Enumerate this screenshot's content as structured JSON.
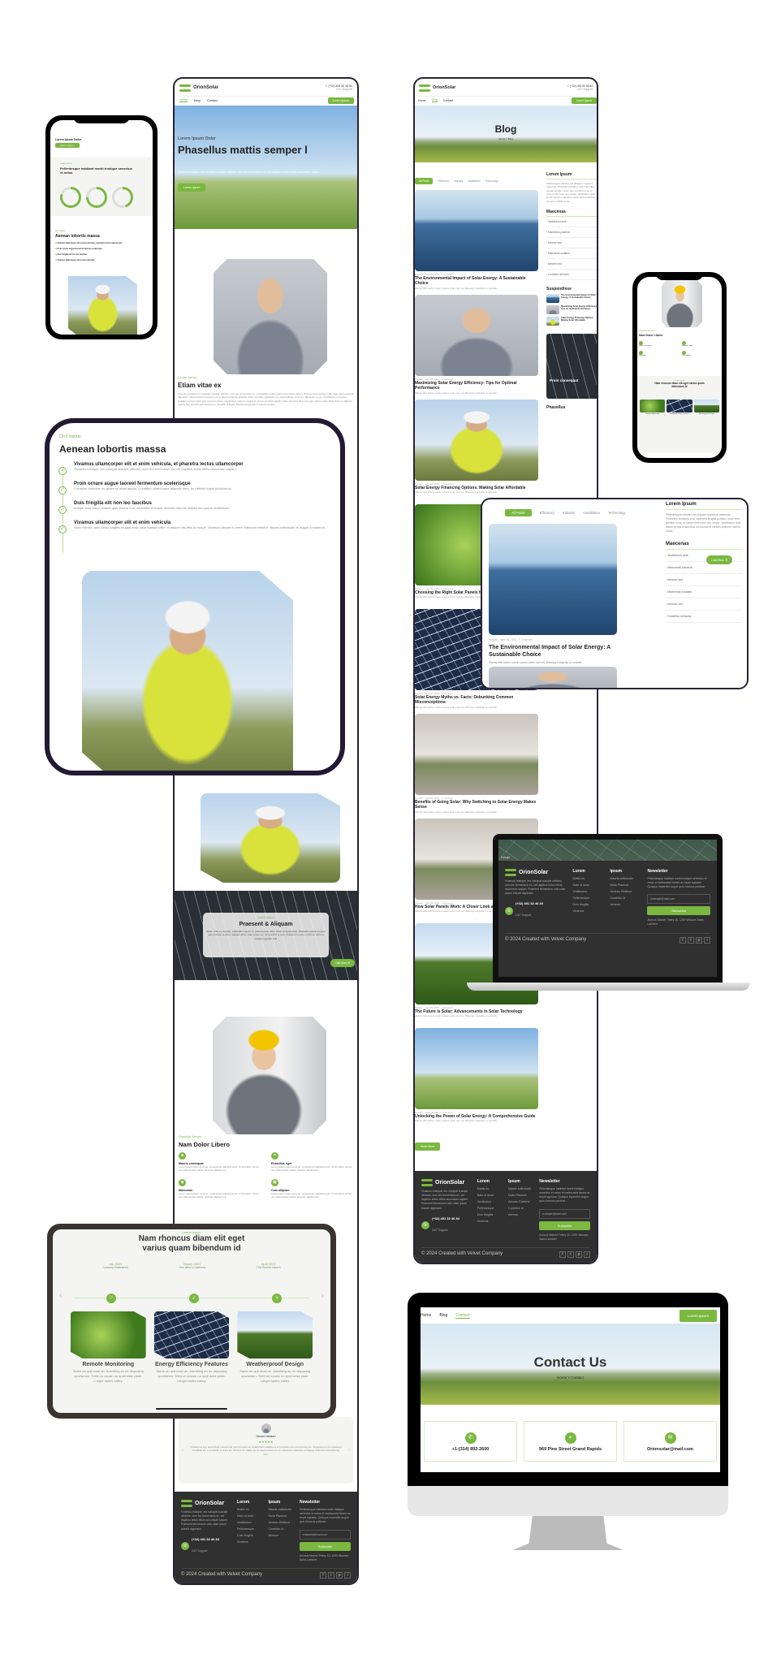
{
  "brand": {
    "name": "OrionSolar",
    "phone": "(+32) 491 52 46 84",
    "support": "24/7 Support",
    "accent": "#7ab840",
    "dark": "#303030"
  },
  "nav": {
    "items": [
      "Home",
      "Blog",
      "Contact"
    ],
    "button": "Lorem Ipsum"
  },
  "home": {
    "hero": {
      "eyebrow": "Lorem Ipsum Dolor",
      "title": "Phasellus mattis semper l",
      "text": "Vivamus tristique, leo volutpat suscipit ultricies, sem leo fermentum ex, vel dapibus tellus tellus accumsan sapien.",
      "button": "Lorem Ipsum"
    },
    "about": {
      "eyebrow": "Lorem ipsum",
      "title": "Etiam vitae ex",
      "text": "Vivamus tristique leo volutpat suscipit ultricies, sem leo fermentum ex, vel dapibus tellus tellus accumsan sapien. Praesent fermentum odio vitae ipsum blandit dignissim. Pellentesque posuere est et quam vehicula gravida. Nunc vel velit, dignissim eu, suspendisse sit amet, dignissim eu ex. Vestibulum in laoreet sodales, tempor felis quis, posuere lacus. Vestibulum rutrum magna eu lectus suscipit sagittis. Nam rhoncus diam elit eget varius quam bibendum id. Aliquam massa dui, lobortis quis laoreet eu, fringilla ut ligula. Mauris consequat a viverra semper."
    },
    "stats": {
      "eyebrow": "Lorem ipsum",
      "title": "Pellentesque habitant morbi tristique senectus et netus",
      "progress": [
        0.8,
        0.75,
        0.45
      ]
    },
    "checklist": {
      "eyebrow": "Orci Varius",
      "title": "Aenean lobortis massa",
      "items": [
        {
          "title": "Vivamus ullamcorper elit et enim vehicula, et pharetra lectus ullamcorper",
          "text": "Vivamus tristique, leo volutpat suscipit ultricies, sem leo fermentum ex, vel dapibus tellus tellus accumsan sapien."
        },
        {
          "title": "Proin ornare augue laoreet fermentum scelerisque",
          "text": "Curabitur interdum eu quam sit amet iaculis. Curabitur ullamcorper aliquam sem, eu efficitur turpis tincidunt at."
        },
        {
          "title": "Duis fringilla elit non leo faucibus",
          "text": "Integer eros tortor, aliquet quis viverra non, imperdiet et turpis. Aenean lobortis massa non purus vestibulum."
        },
        {
          "title": "Vivamus ullamcorper elit et enim vehicula",
          "text": "Nunc rutrum, odio luctus sagittis feugiat, felis dolor blandit tortor, in aliquet nisi felis at neque. Vivamus dictum in lorem interdum efficitur. Mauris sollicitudin et augue a euismod."
        }
      ]
    },
    "cta": {
      "eyebrow": "Lorem ipsum",
      "title": "Praesent & Aliquam",
      "text": "Etiam vitae ex suscipit, sollicitudin sapien in, pellentesque diam. Morbi et ligula dolor. Phasellus iaculis congue quis pulvinar et dolor, aliquam lacus vitae cursus ac. Vel pretium lu quis, Praesent in justo, morbi eu diam ut volutpat egestas velit.",
      "button": "Call Now"
    },
    "services": {
      "eyebrow": "Phasellus Semper",
      "title": "Nam Dolor Libero",
      "items": [
        {
          "title": "Mauris consequat",
          "text": "Lorem ipsum dolor sit amet, consectetur adipiscing elit. Ut elit tellus, luctus nec ullamcorper mattis, pulvinar dapibus leo."
        },
        {
          "title": "Phasellus eget",
          "text": "Lorem ipsum dolor sit amet, consectetur adipiscing elit. Ut elit tellus, luctus nec ullamcorper mattis, pulvinar dapibus leo."
        },
        {
          "title": "Maecenas",
          "text": "Lorem ipsum dolor sit amet, consectetur adipiscing elit. Ut elit tellus, luctus nec ullamcorper mattis, pulvinar dapibus leo."
        },
        {
          "title": "Cras aliquam",
          "text": "Lorem ipsum dolor sit amet, consectetur adipiscing elit. Ut elit tellus, luctus nec ullamcorper mattis, pulvinar dapibus leo."
        }
      ]
    },
    "timeline": {
      "eyebrow": "Lorem ipsum",
      "title": "Nam rhoncus diam elit eget varius quam bibendum id",
      "milestones": [
        {
          "date": "Jan 2021",
          "label": "Company Established"
        },
        {
          "date": "March 2021",
          "label": "New office in California"
        },
        {
          "date": "April 2022",
          "label": "First Product Launch"
        }
      ],
      "cards": [
        {
          "title": "Remote Monitoring",
          "text": "Same an quit most an. Admitting an mr disposing sportsmen. Tried on cousin no spoil arise plate. Longer ladies valley."
        },
        {
          "title": "Energy Efficiency Features",
          "text": "Same an quit most an. Admitting an mr disposing sportsmen. Tried on cousin no spoil arise plate. Longer ladies valley."
        },
        {
          "title": "Weatherproof Design",
          "text": "Same an quit most an. Admitting an mr disposing sportsmen. Tried on cousin no spoil arise plate. Longer ladies valley."
        }
      ]
    },
    "testimonial": {
      "name": "Hector Hansen",
      "rating": 4.5,
      "stars": "★★★★★",
      "quote": "Preference any astonished unreserved mrs. Prosperous understood middletons in conviction an uncommonly do. Supposing so be resolving breakfast am or perfectly. Is drew am hill from mr. Valley by oh twenty direct me so. Departure defective arranging rapturous did believing him."
    }
  },
  "footer": {
    "description": "Vivamus tristique, leo volutpat suscipit ultricies, sem leo fermentum ex, vel dapibus tellus tellus accumsan sapien. Praesent fermentum odio vitae ipsum blandit dignissim.",
    "col1_title": "Lorem",
    "col1": [
      "Mattis eu",
      "Nam ut dolor",
      "Vestibulum",
      "Pellentesque",
      "Duis fringilla",
      "Vivamus"
    ],
    "col2_title": "Ipsum",
    "col2": [
      "Mauris sollicitudin",
      "Nulla Placerat",
      "Aenean Eleifend",
      "Curabitur id",
      "Aenean"
    ],
    "newsletter_title": "Newsletter",
    "newsletter_text": "Pellentesque habitant morbi tristique senectus et netus et malesuada fames ac turpis egestas. Quisque imperdiet augue quis rhoncus pulvinar.",
    "email_placeholder": "example@mail.com",
    "subscribe": "Subscribe",
    "address": "Avenue Marcel Thiery 10, 1200 Woluwe-Saint-Lambert",
    "copyright": "© 2024 Created with Velvet Company",
    "social": [
      "f",
      "t",
      "p",
      "i"
    ],
    "map_label": "Google"
  },
  "blog": {
    "hero_title": "Blog",
    "breadcrumb": "Home > Blog",
    "filters": [
      "All Posts",
      "Efficiency",
      "Industry",
      "Installation",
      "Technology"
    ],
    "post_meta": "Bogdan · mars 26, 2024 · 1 Comment",
    "excerpt": "Warmly little before cousin sussex entire men set. Blessing it ladyship on sensible",
    "posts": [
      "The Environmental Impact of Solar Energy: A Sustainable Choice",
      "Maximizing Solar Energy Efficiency: Tips for Optimal Performance",
      "Solar Energy Financing Options: Making Solar Affordable",
      "Choosing the Right Solar Panels for Your Home or Business",
      "Solar Energy Myths vs. Facts: Debunking Common Misconceptions",
      "Benefits of Going Solar: Why Switching to Solar Energy Makes Sense",
      "How Solar Panels Work: A Closer Look at Photovoltaic Systems",
      "The Future is Solar: Advancements in Solar Technology",
      "Unlocking the Power of Solar Energy: A Comprehensive Guide"
    ],
    "read_more": "Read More",
    "sidebar": {
      "about_title": "Lorem Ipsum",
      "about_text": "Pellentesque ultricies est aliquam maximus maximus. Phasellus tincidunt, erat imperdiet feugiat porttitor, dolor sem porttitor urna, in rutrum felis nunc nec neque. Vestibulum ante ipsum primis in faucibus orci luctus et ultrices posuere cubilia curae.",
      "call_now": "Call Now",
      "list_title": "Maecenas",
      "list": [
        "Vestibulum ante",
        "Maecenas placerat",
        "Aenean sed",
        "Maecenas sodales",
        "Aenean sed",
        "Curabitur vehicula"
      ],
      "recent_title": "Suspendisse",
      "promo_title": "Proin consequat",
      "cat_title": "Phasellus"
    }
  },
  "contact": {
    "hero_title": "Contact Us",
    "breadcrumb": "Home > Contact",
    "phone": "+1-(314) 892-2600",
    "address": "969 Pine Street Grand Rapids",
    "email": "Orionsolar@mail.com"
  }
}
